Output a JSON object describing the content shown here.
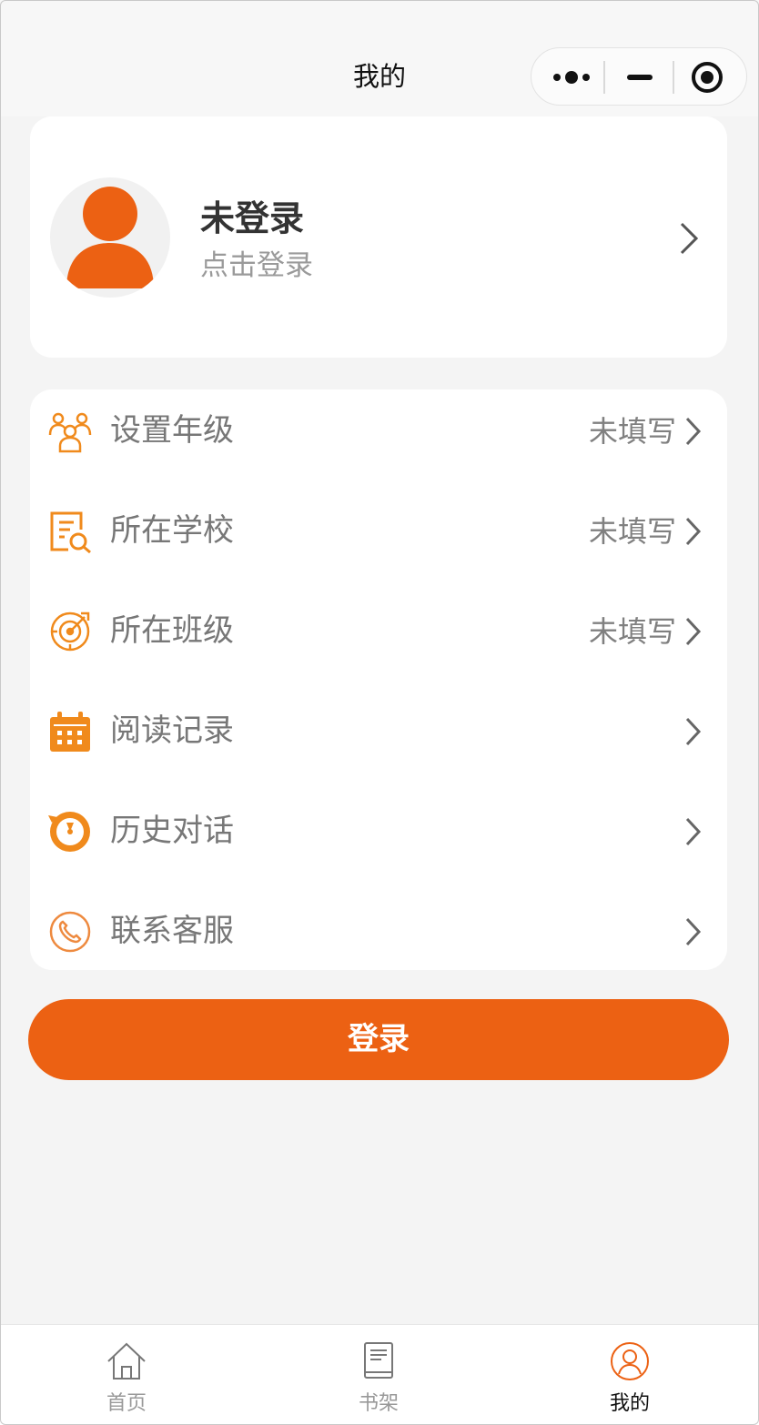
{
  "navbar": {
    "title": "我的",
    "capsule_icons": [
      "more-dots-icon",
      "minimize-icon",
      "target-close-icon"
    ]
  },
  "profile": {
    "name": "未登录",
    "subtitle": "点击登录",
    "avatar_icon": "user-avatar-icon"
  },
  "menu": [
    {
      "label": "设置年级",
      "value": "未填写",
      "icon": "group-people-icon"
    },
    {
      "label": "所在学校",
      "value": "未填写",
      "icon": "document-search-icon"
    },
    {
      "label": "所在班级",
      "value": "未填写",
      "icon": "target-arrow-icon"
    },
    {
      "label": "阅读记录",
      "value": "",
      "icon": "calendar-icon"
    },
    {
      "label": "历史对话",
      "value": "",
      "icon": "history-clock-icon"
    },
    {
      "label": "联系客服",
      "value": "",
      "icon": "phone-icon"
    }
  ],
  "login_button": "登录",
  "tabbar": [
    {
      "label": "首页",
      "icon": "home-icon",
      "active": false
    },
    {
      "label": "书架",
      "icon": "book-icon",
      "active": false
    },
    {
      "label": "我的",
      "icon": "user-circle-icon",
      "active": true
    }
  ],
  "colors": {
    "accent": "#ec6113",
    "icon_orange": "#f08a1c",
    "background": "#f4f4f4"
  }
}
